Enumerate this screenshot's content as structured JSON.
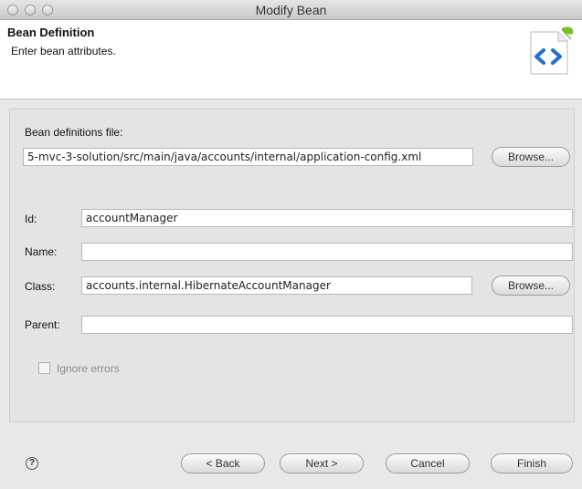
{
  "window": {
    "title": "Modify Bean"
  },
  "header": {
    "title": "Bean Definition",
    "description": "Enter bean attributes.",
    "icon": "xml-bean-icon"
  },
  "form": {
    "bean_file_label": "Bean definitions file:",
    "bean_file_value": "5-mvc-3-solution/src/main/java/accounts/internal/application-config.xml",
    "browse_file_label": "Browse...",
    "id_label": "Id:",
    "id_value": "accountManager",
    "name_label": "Name:",
    "name_value": "",
    "class_label": "Class:",
    "class_value": "accounts.internal.HibernateAccountManager",
    "browse_class_label": "Browse...",
    "parent_label": "Parent:",
    "parent_value": "",
    "ignore_errors_label": "Ignore errors",
    "ignore_errors_checked": false
  },
  "footer": {
    "help_icon": "?",
    "back_label": "< Back",
    "next_label": "Next >",
    "cancel_label": "Cancel",
    "finish_label": "Finish"
  },
  "colors": {
    "icon_blue": "#1f6fcf",
    "icon_leaf": "#7bbf2a"
  }
}
